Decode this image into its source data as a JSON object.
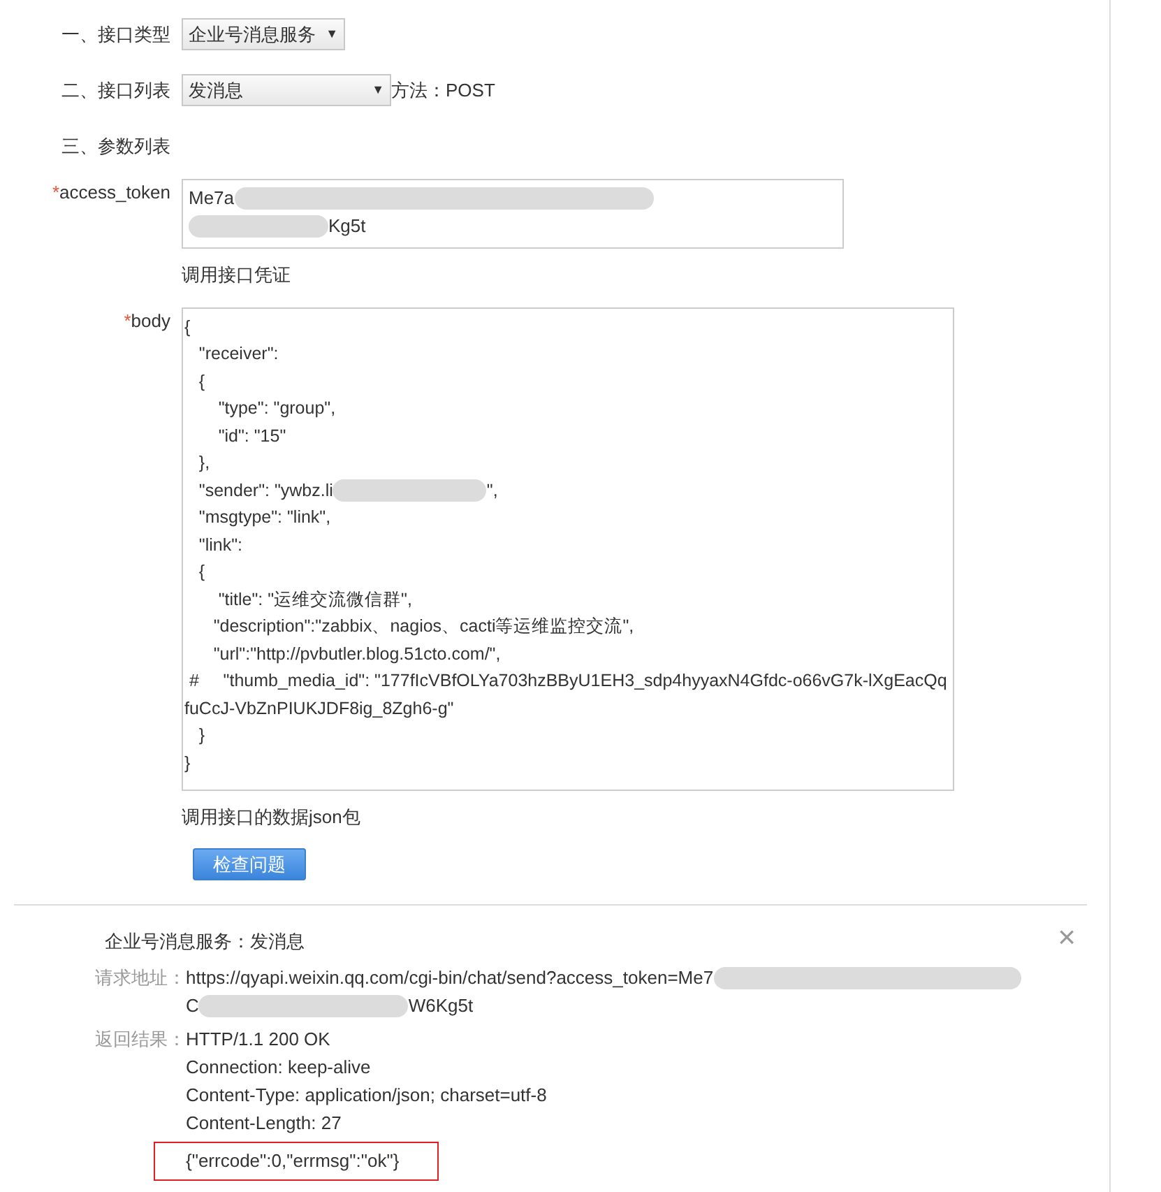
{
  "interface_type": {
    "label": "一、接口类型",
    "value": "企业号消息服务",
    "arrow": "▼"
  },
  "interface_list": {
    "label": "二、接口列表",
    "value": "发消息",
    "arrow": "▼",
    "method": "方法：POST"
  },
  "params_heading": "三、参数列表",
  "params": [
    {
      "required_mark": "*",
      "name": "access_token",
      "kind": "token",
      "lines": [
        [
          {
            "kind": "text",
            "text": "Me7a"
          },
          {
            "kind": "redaction"
          }
        ],
        [
          {
            "kind": "redaction"
          },
          {
            "kind": "text",
            "text": "Kg5t"
          }
        ]
      ],
      "hint": "调用接口凭证"
    },
    {
      "required_mark": "*",
      "name": "body",
      "kind": "code",
      "lines": [
        [
          {
            "kind": "text",
            "text": "{"
          }
        ],
        [
          {
            "kind": "text",
            "text": "   \"receiver\":"
          }
        ],
        [
          {
            "kind": "text",
            "text": "   {"
          }
        ],
        [
          {
            "kind": "text",
            "text": "       \"type\": \"group\","
          }
        ],
        [
          {
            "kind": "text",
            "text": "       \"id\": \"15\""
          }
        ],
        [
          {
            "kind": "text",
            "text": "   },"
          }
        ],
        [
          {
            "kind": "text",
            "text": "   \"sender\": \"ywbz.li"
          },
          {
            "kind": "redaction"
          },
          {
            "kind": "text",
            "text": "\","
          }
        ],
        [
          {
            "kind": "text",
            "text": "   \"msgtype\": \"link\","
          }
        ],
        [
          {
            "kind": "text",
            "text": "   \"link\":"
          }
        ],
        [
          {
            "kind": "text",
            "text": "   {"
          }
        ],
        [
          {
            "kind": "text",
            "text": "       \"title\": \"运维交流微信群\","
          }
        ],
        [
          {
            "kind": "text",
            "text": "      \"description\":\"zabbix、nagios、cacti等运维监控交流\","
          }
        ],
        [
          {
            "kind": "text",
            "text": "      \"url\":\"http://pvbutler.blog.51cto.com/\","
          }
        ],
        [
          {
            "kind": "text",
            "text": " #     \"thumb_media_id\": \"177fIcVBfOLYa703hzBByU1EH3_sdp4hyyaxN4Gfdc-o66vG7k-lXgEacQqfuCcJ-VbZnPIUKJDF8ig_8Zgh6-g\""
          }
        ],
        [
          {
            "kind": "text",
            "text": "   }"
          }
        ],
        [
          {
            "kind": "text",
            "text": "}"
          }
        ]
      ],
      "hint": "调用接口的数据json包"
    }
  ],
  "check_button": "检查问题",
  "result": {
    "title": "企业号消息服务：发消息",
    "close": "×",
    "request_label": "请求地址：",
    "request_lines": [
      [
        {
          "kind": "text",
          "text": "https://qyapi.weixin.qq.com/cgi-bin/chat/send?access_token=Me7"
        },
        {
          "kind": "redaction"
        }
      ],
      [
        {
          "kind": "text",
          "text": "C"
        },
        {
          "kind": "redaction"
        },
        {
          "kind": "text",
          "text": "W6Kg5t"
        }
      ]
    ],
    "response_label": "返回结果：",
    "response_lines": [
      "HTTP/1.1 200 OK",
      "Connection: keep-alive",
      "Content-Type: application/json; charset=utf-8",
      "Content-Length: 27"
    ],
    "response_body": "{\"errcode\":0,\"errmsg\":\"ok\"}",
    "body_highlighted": true
  }
}
